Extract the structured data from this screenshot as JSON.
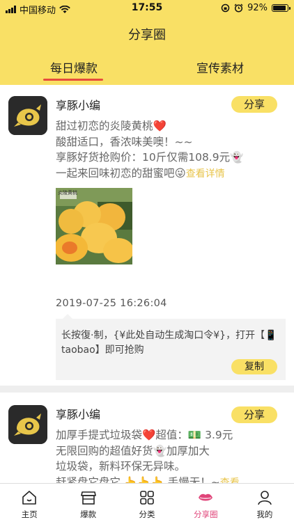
{
  "status_bar": {
    "carrier": "中国移动",
    "time": "17:55",
    "battery": "92%",
    "battery_level": 0.92
  },
  "header": {
    "title": "分享圈",
    "tabs": [
      {
        "label": "每日爆款",
        "active": true
      },
      {
        "label": "宣传素材",
        "active": false
      }
    ]
  },
  "posts": [
    {
      "author": "享豚小编",
      "share_label": "分享",
      "lines": [
        "甜过初恋的炎陵黄桃",
        "酸甜适口，香浓味美噢！~~",
        "享豚好货抢购价：10斤仅需108.9元",
        "一起来回味初恋的甜蜜吧"
      ],
      "detail_link": "查看详情",
      "photo_caption": "炎陵黄桃",
      "timestamp": "2019-07-25 16:26:04",
      "copy_text": "长按復·制，{¥此处自动生成淘口令¥}，打开【📱 taobao】即可抢购",
      "copy_label": "复制"
    },
    {
      "author": "享豚小编",
      "share_label": "分享",
      "lines": [
        "加厚手提式垃圾袋",
        "超值：",
        "3.9元",
        "无限回购的超值好货",
        "加厚加大",
        "垃圾袋，新料环保无异味。",
        "赶紧盘它盘它",
        "手慢无！~",
        "查看"
      ]
    }
  ],
  "tabbar": {
    "items": [
      {
        "label": "主页",
        "icon": "home-icon"
      },
      {
        "label": "爆款",
        "icon": "shop-icon"
      },
      {
        "label": "分类",
        "icon": "grid-icon"
      },
      {
        "label": "分享圈",
        "icon": "lips-icon",
        "active": true
      },
      {
        "label": "我的",
        "icon": "user-icon"
      }
    ]
  },
  "colors": {
    "accent_yellow": "#f9e065",
    "tab_underline": "#e74c3c",
    "active_tab": "#e0457a",
    "link": "#e8c44a"
  }
}
